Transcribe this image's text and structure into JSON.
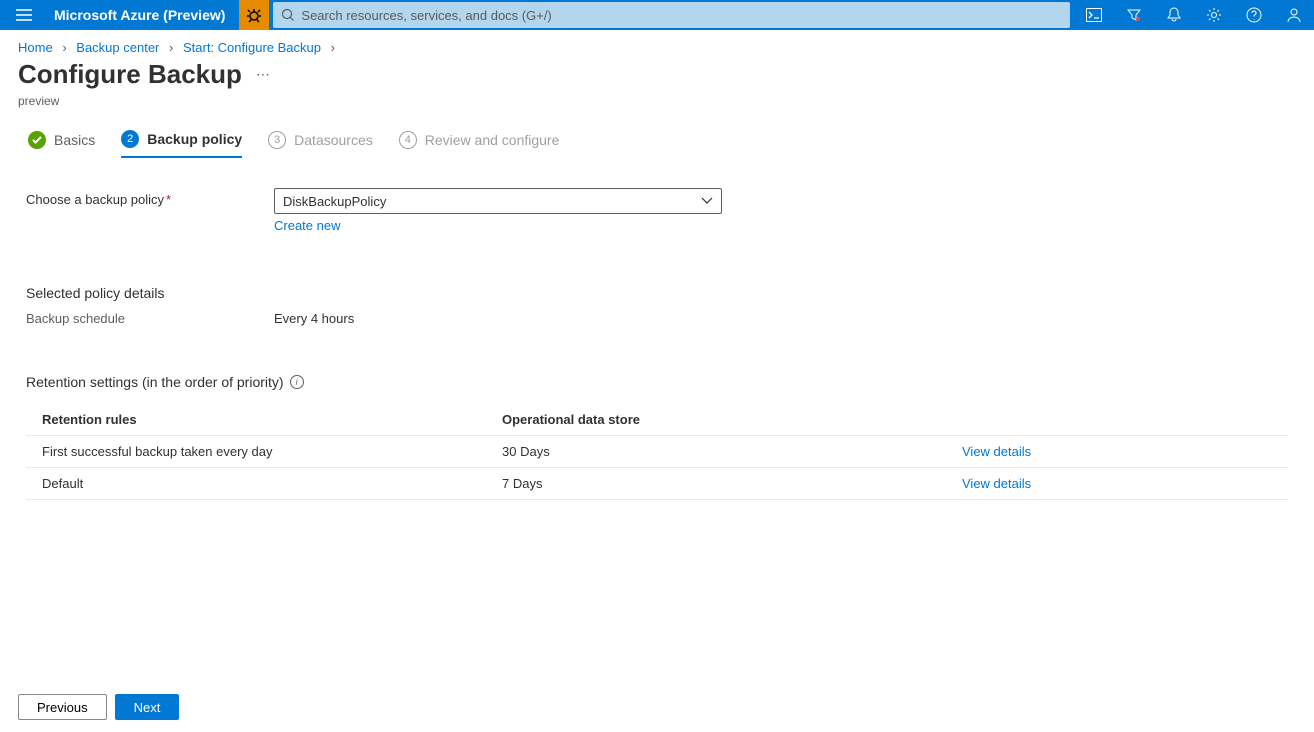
{
  "header": {
    "brand": "Microsoft Azure (Preview)",
    "search_placeholder": "Search resources, services, and docs (G+/)"
  },
  "breadcrumb": {
    "items": [
      "Home",
      "Backup center",
      "Start: Configure Backup"
    ]
  },
  "page": {
    "title": "Configure Backup",
    "subtitle": "preview"
  },
  "steps": [
    {
      "label": "Basics",
      "state": "done"
    },
    {
      "label": "Backup policy",
      "state": "active",
      "num": "2"
    },
    {
      "label": "Datasources",
      "state": "future",
      "num": "3"
    },
    {
      "label": "Review and configure",
      "state": "future",
      "num": "4"
    }
  ],
  "policy": {
    "field_label": "Choose a backup policy",
    "selected": "DiskBackupPolicy",
    "create_link": "Create new"
  },
  "details": {
    "heading": "Selected policy details",
    "schedule_label": "Backup schedule",
    "schedule_value": "Every 4 hours"
  },
  "retention": {
    "heading": "Retention settings (in the order of priority)",
    "columns": [
      "Retention rules",
      "Operational data store",
      ""
    ],
    "rows": [
      {
        "rule": "First successful backup taken every day",
        "store": "30 Days",
        "action": "View details"
      },
      {
        "rule": "Default",
        "store": "7 Days",
        "action": "View details"
      }
    ]
  },
  "footer": {
    "previous": "Previous",
    "next": "Next"
  }
}
